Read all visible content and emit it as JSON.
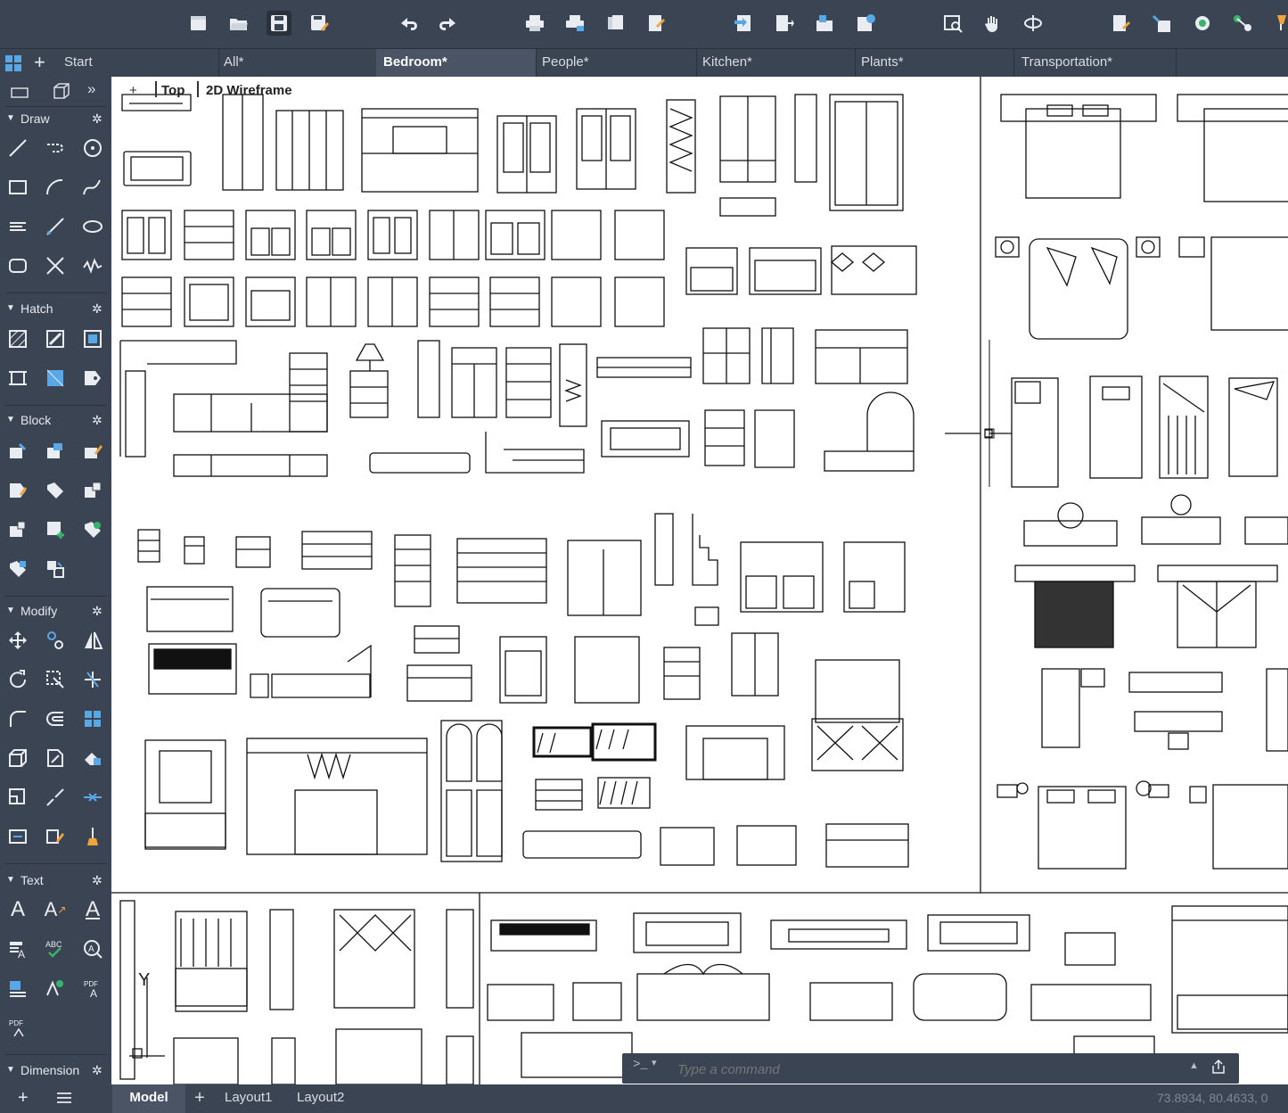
{
  "toolbar": {
    "buttons": [
      "new-file-icon",
      "open-file-icon",
      "save-icon",
      "save-as-icon",
      "undo-icon",
      "redo-icon",
      "print-icon",
      "batch-print-icon",
      "publish-icon",
      "export-icon",
      "import-icon",
      "attach-icon",
      "sheet-set-icon",
      "share-icon",
      "zoom-window-icon",
      "pan-hand-icon",
      "orbit-icon",
      "properties-icon",
      "match-props-icon",
      "layer-icon",
      "node-icon",
      "lamp-icon"
    ]
  },
  "tabs": {
    "home_icon": "grid-icon",
    "add": "+",
    "items": [
      {
        "label": "Start"
      },
      {
        "label": "All*"
      },
      {
        "label": "Bedroom*"
      },
      {
        "label": "People*"
      },
      {
        "label": "Kitchen*"
      },
      {
        "label": "Plants*"
      },
      {
        "label": "Transportation*"
      }
    ],
    "active": "Bedroom*"
  },
  "sidebar": {
    "collapse": "»",
    "sections": [
      {
        "label": "Draw"
      },
      {
        "label": "Hatch"
      },
      {
        "label": "Block"
      },
      {
        "label": "Modify"
      },
      {
        "label": "Text"
      },
      {
        "label": "Dimension"
      }
    ],
    "text_tool_labels": {
      "abc": "ABC",
      "pdf1": "PDF",
      "pdf2": "PDF"
    }
  },
  "viewport": {
    "plus": "+",
    "view": "Top",
    "style": "2D Wireframe",
    "ucs_y": "Y"
  },
  "command": {
    "prompt": ">_",
    "placeholder": "Type a command"
  },
  "status": {
    "tabs": [
      {
        "label": "Model"
      },
      {
        "label": "+"
      },
      {
        "label": "Layout1"
      },
      {
        "label": "Layout2"
      }
    ],
    "active": "Model",
    "coords": "73.8934, 80.4633, 0"
  }
}
